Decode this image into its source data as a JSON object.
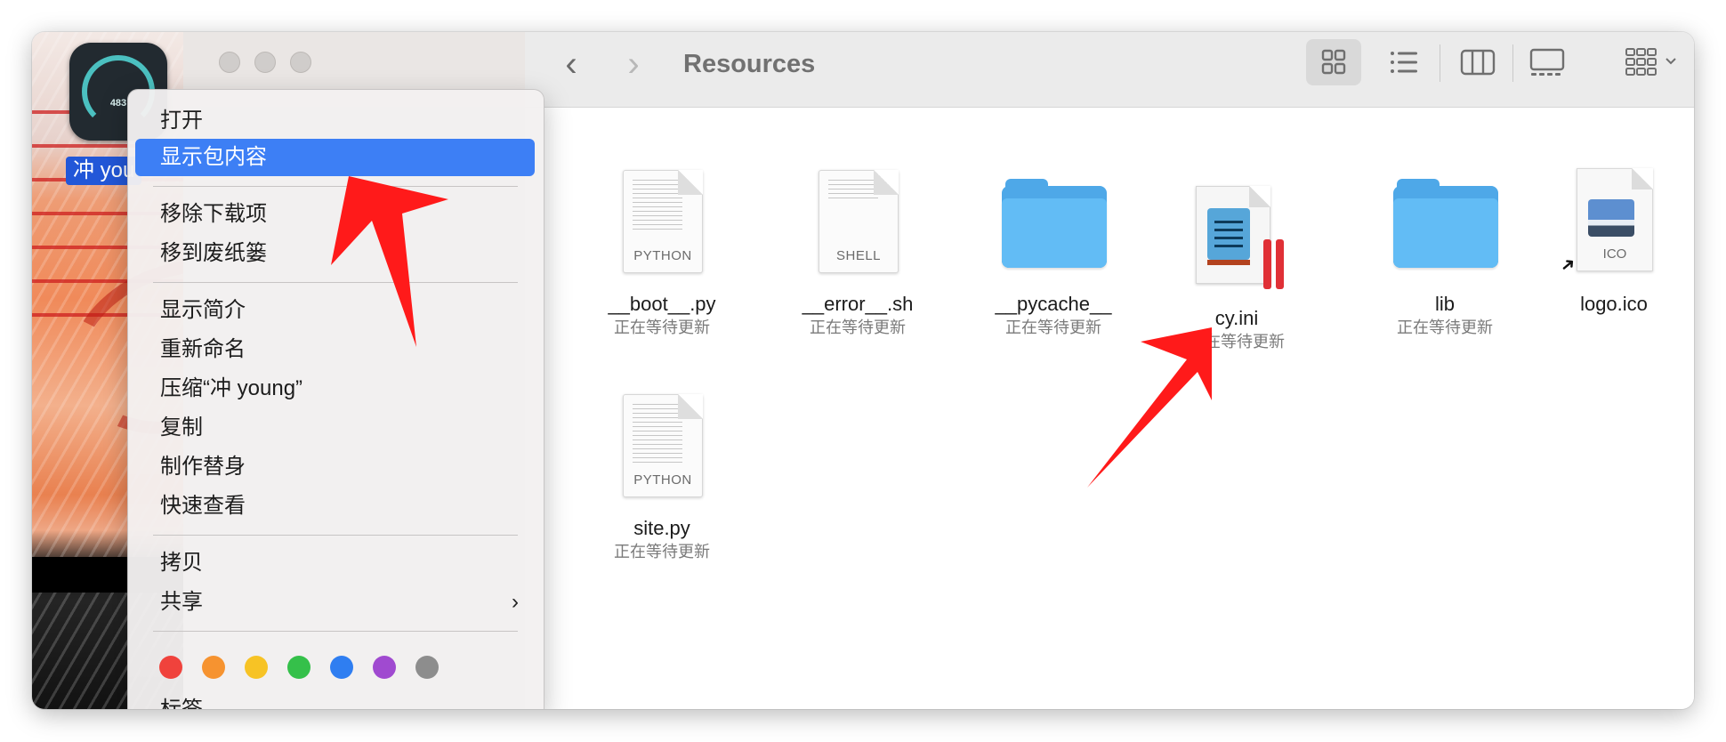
{
  "window": {
    "title": "Resources",
    "view_modes": [
      "icons",
      "list",
      "columns",
      "gallery"
    ],
    "active_view": "icons"
  },
  "desktop": {
    "app_icon_badge": "483",
    "app_label": "冲 you"
  },
  "files": [
    {
      "name": "__boot__.py",
      "status": "正在等待更新",
      "kind": "document",
      "type_label": "PYTHON"
    },
    {
      "name": "__error__.sh",
      "status": "正在等待更新",
      "kind": "document",
      "type_label": "SHELL"
    },
    {
      "name": "__pycache__",
      "status": "正在等待更新",
      "kind": "folder"
    },
    {
      "name": "cy.ini",
      "status": "正在等待更新",
      "kind": "ini"
    },
    {
      "name": "lib",
      "status": "正在等待更新",
      "kind": "folder"
    },
    {
      "name": "logo.ico",
      "status": "",
      "kind": "image",
      "type_label": "ICO"
    },
    {
      "name": "site.py",
      "status": "正在等待更新",
      "kind": "document",
      "type_label": "PYTHON"
    }
  ],
  "context_menu": {
    "items": [
      {
        "label": "打开"
      },
      {
        "label": "显示包内容",
        "selected": true
      },
      {
        "label": "移除下载项"
      },
      {
        "label": "移到废纸篓"
      },
      {
        "label": "显示简介"
      },
      {
        "label": "重新命名"
      },
      {
        "label": "压缩“冲 young”"
      },
      {
        "label": "复制"
      },
      {
        "label": "制作替身"
      },
      {
        "label": "快速查看"
      },
      {
        "label": "拷贝"
      },
      {
        "label": "共享",
        "submenu": true
      },
      {
        "label": "标签"
      }
    ],
    "tag_colors": [
      "#f0423c",
      "#f69330",
      "#f7c325",
      "#35c04a",
      "#2f7ef1",
      "#a04ad0",
      "#8d8d8d"
    ]
  },
  "annotation_color": "#ff1a1a"
}
